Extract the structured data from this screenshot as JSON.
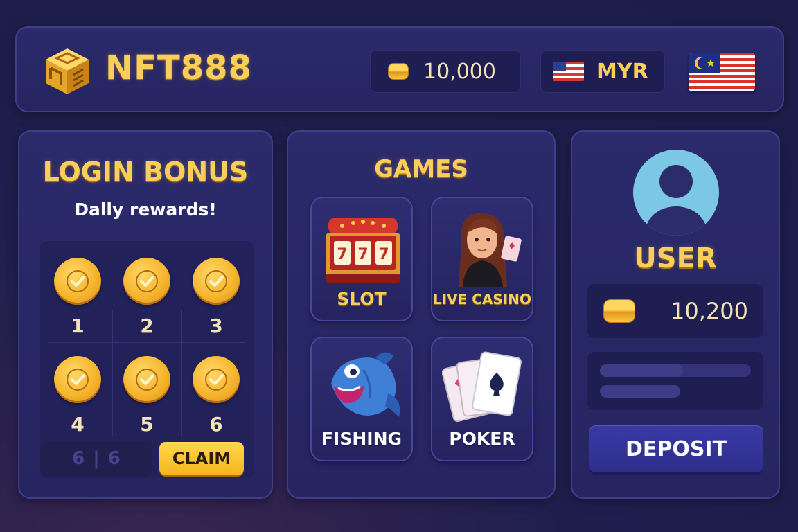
{
  "header": {
    "brand": "NFT888",
    "balance": "10,000",
    "currency": "MYR",
    "icons": {
      "logo": "cube-logo-icon",
      "coin": "coin-icon",
      "currency_flag": "us-flag-icon",
      "language_flag": "malaysia-flag-icon"
    }
  },
  "login_bonus": {
    "title": "LOGIN BONUS",
    "subtitle": "Dally rewards!",
    "days": [
      {
        "label": "1",
        "claimed": true
      },
      {
        "label": "2",
        "claimed": true
      },
      {
        "label": "3",
        "claimed": true
      },
      {
        "label": "4",
        "claimed": true
      },
      {
        "label": "5",
        "claimed": true
      },
      {
        "label": "6",
        "claimed": true
      }
    ],
    "progress_left": "6",
    "progress_sep": "|",
    "progress_right": "6",
    "claim_label": "CLAIM"
  },
  "games": {
    "title": "GAMES",
    "tiles": [
      {
        "label": "SLOT",
        "icon": "slot-machine-icon"
      },
      {
        "label": "LIVE CASINO",
        "icon": "dealer-icon"
      },
      {
        "label": "FISHING",
        "icon": "fish-icon"
      },
      {
        "label": "POKER",
        "icon": "playing-cards-icon"
      }
    ]
  },
  "user": {
    "name": "USER",
    "balance": "10,200",
    "avatar_icon": "user-avatar-icon",
    "progress": [
      0.55,
      0.53
    ],
    "deposit_label": "DEPOSIT"
  },
  "colors": {
    "background": "#1f1f4e",
    "panel": "#2b2a6b",
    "gold": "#f7cf5a",
    "claim_button": "#f4b51d",
    "deposit_button": "#3a3aa6"
  }
}
